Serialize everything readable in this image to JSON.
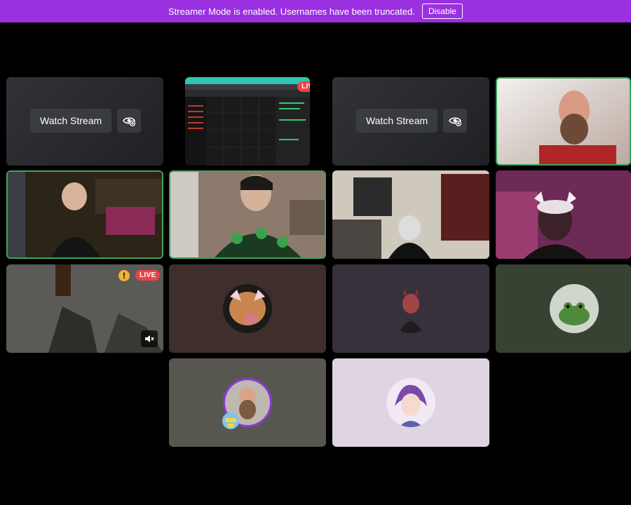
{
  "banner": {
    "message": "Streamer Mode is enabled. Usernames have been truncated.",
    "button_label": "Disable"
  },
  "stream_tiles": {
    "watch_label": "Watch Stream",
    "live_label": "LIVE"
  },
  "colors": {
    "banner": "#9b30e0",
    "speaking_border": "#3ba55c",
    "live_badge": "#ed4245",
    "warning": "#f0b232"
  }
}
